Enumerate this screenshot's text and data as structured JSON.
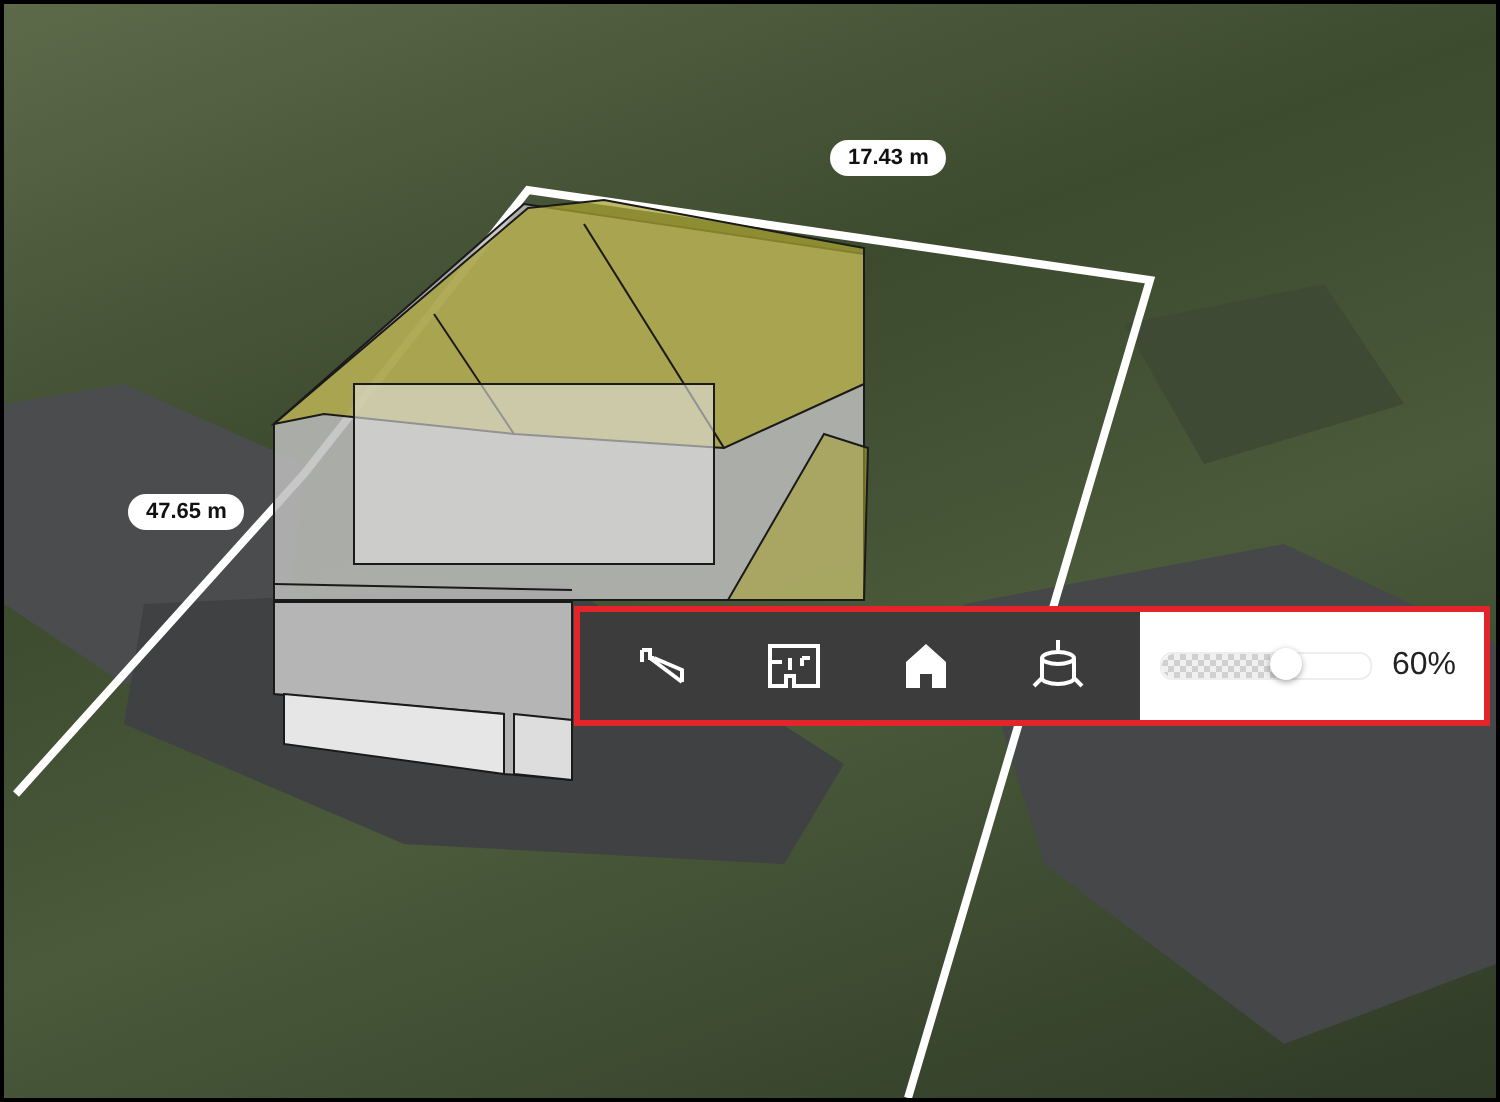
{
  "measurements": [
    {
      "text": "17.43 m"
    },
    {
      "text": "47.65 m"
    }
  ],
  "toolbar": {
    "opacity": {
      "level": 0.6,
      "reading": "60%"
    }
  }
}
